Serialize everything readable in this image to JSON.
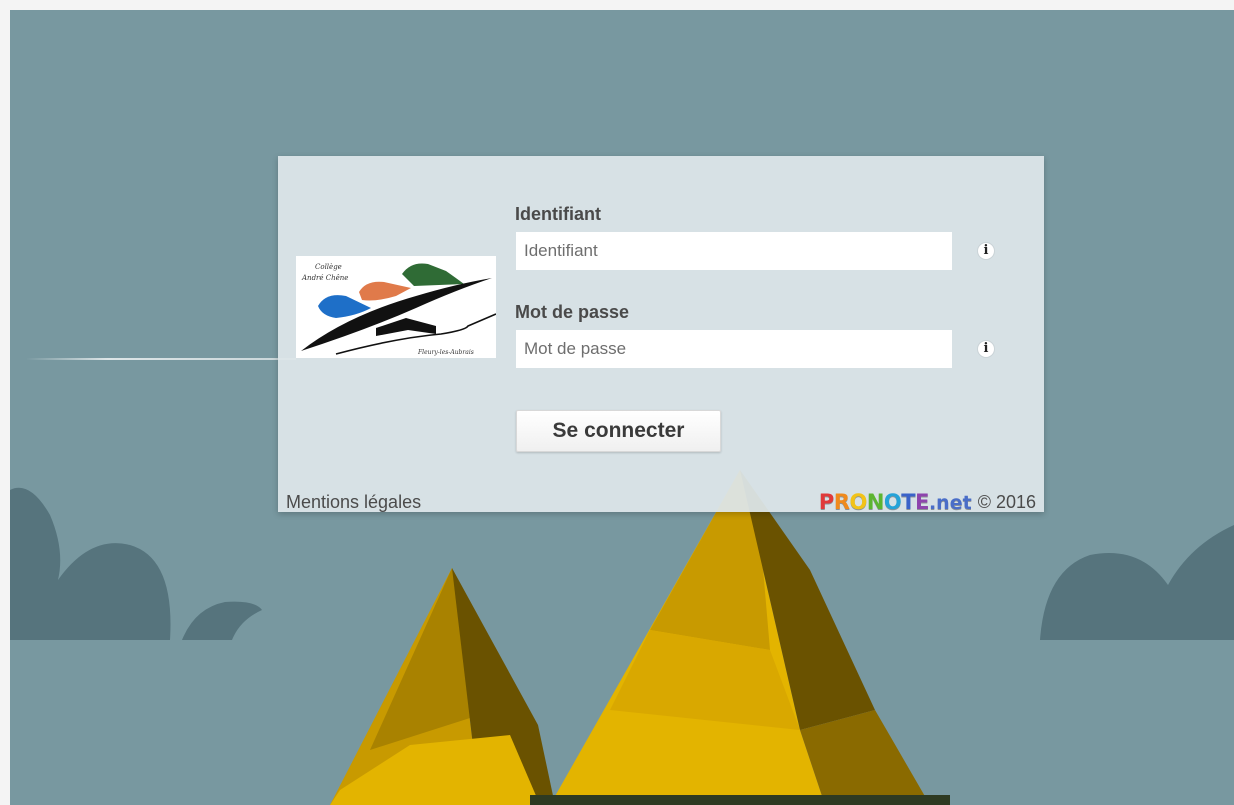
{
  "login": {
    "identifiant_label": "Identifiant",
    "identifiant_placeholder": "Identifiant",
    "password_label": "Mot de passe",
    "password_placeholder": "Mot de passe",
    "connect_button": "Se connecter"
  },
  "logo": {
    "line1": "Collège",
    "line2": "André Chêne",
    "town": "Fleury-les-Aubrais"
  },
  "footer": {
    "legal_link": "Mentions légales",
    "brand_letters": [
      {
        "char": "P",
        "color": "#e03a3a"
      },
      {
        "char": "R",
        "color": "#f08a1c"
      },
      {
        "char": "O",
        "color": "#f2c318"
      },
      {
        "char": "N",
        "color": "#5cb531"
      },
      {
        "char": "O",
        "color": "#25a3d8"
      },
      {
        "char": "T",
        "color": "#3a63c9"
      },
      {
        "char": "E",
        "color": "#8e44ad"
      }
    ],
    "brand_suffix": ".net",
    "copyright": "© 2016"
  },
  "icons": {
    "info": "info-icon",
    "info_glyph": "i"
  },
  "colors": {
    "sky": "#7898a0",
    "panel": "#dde6e9",
    "mountain_gold": "#e3b400",
    "mountain_shadow": "#8a6a00"
  }
}
